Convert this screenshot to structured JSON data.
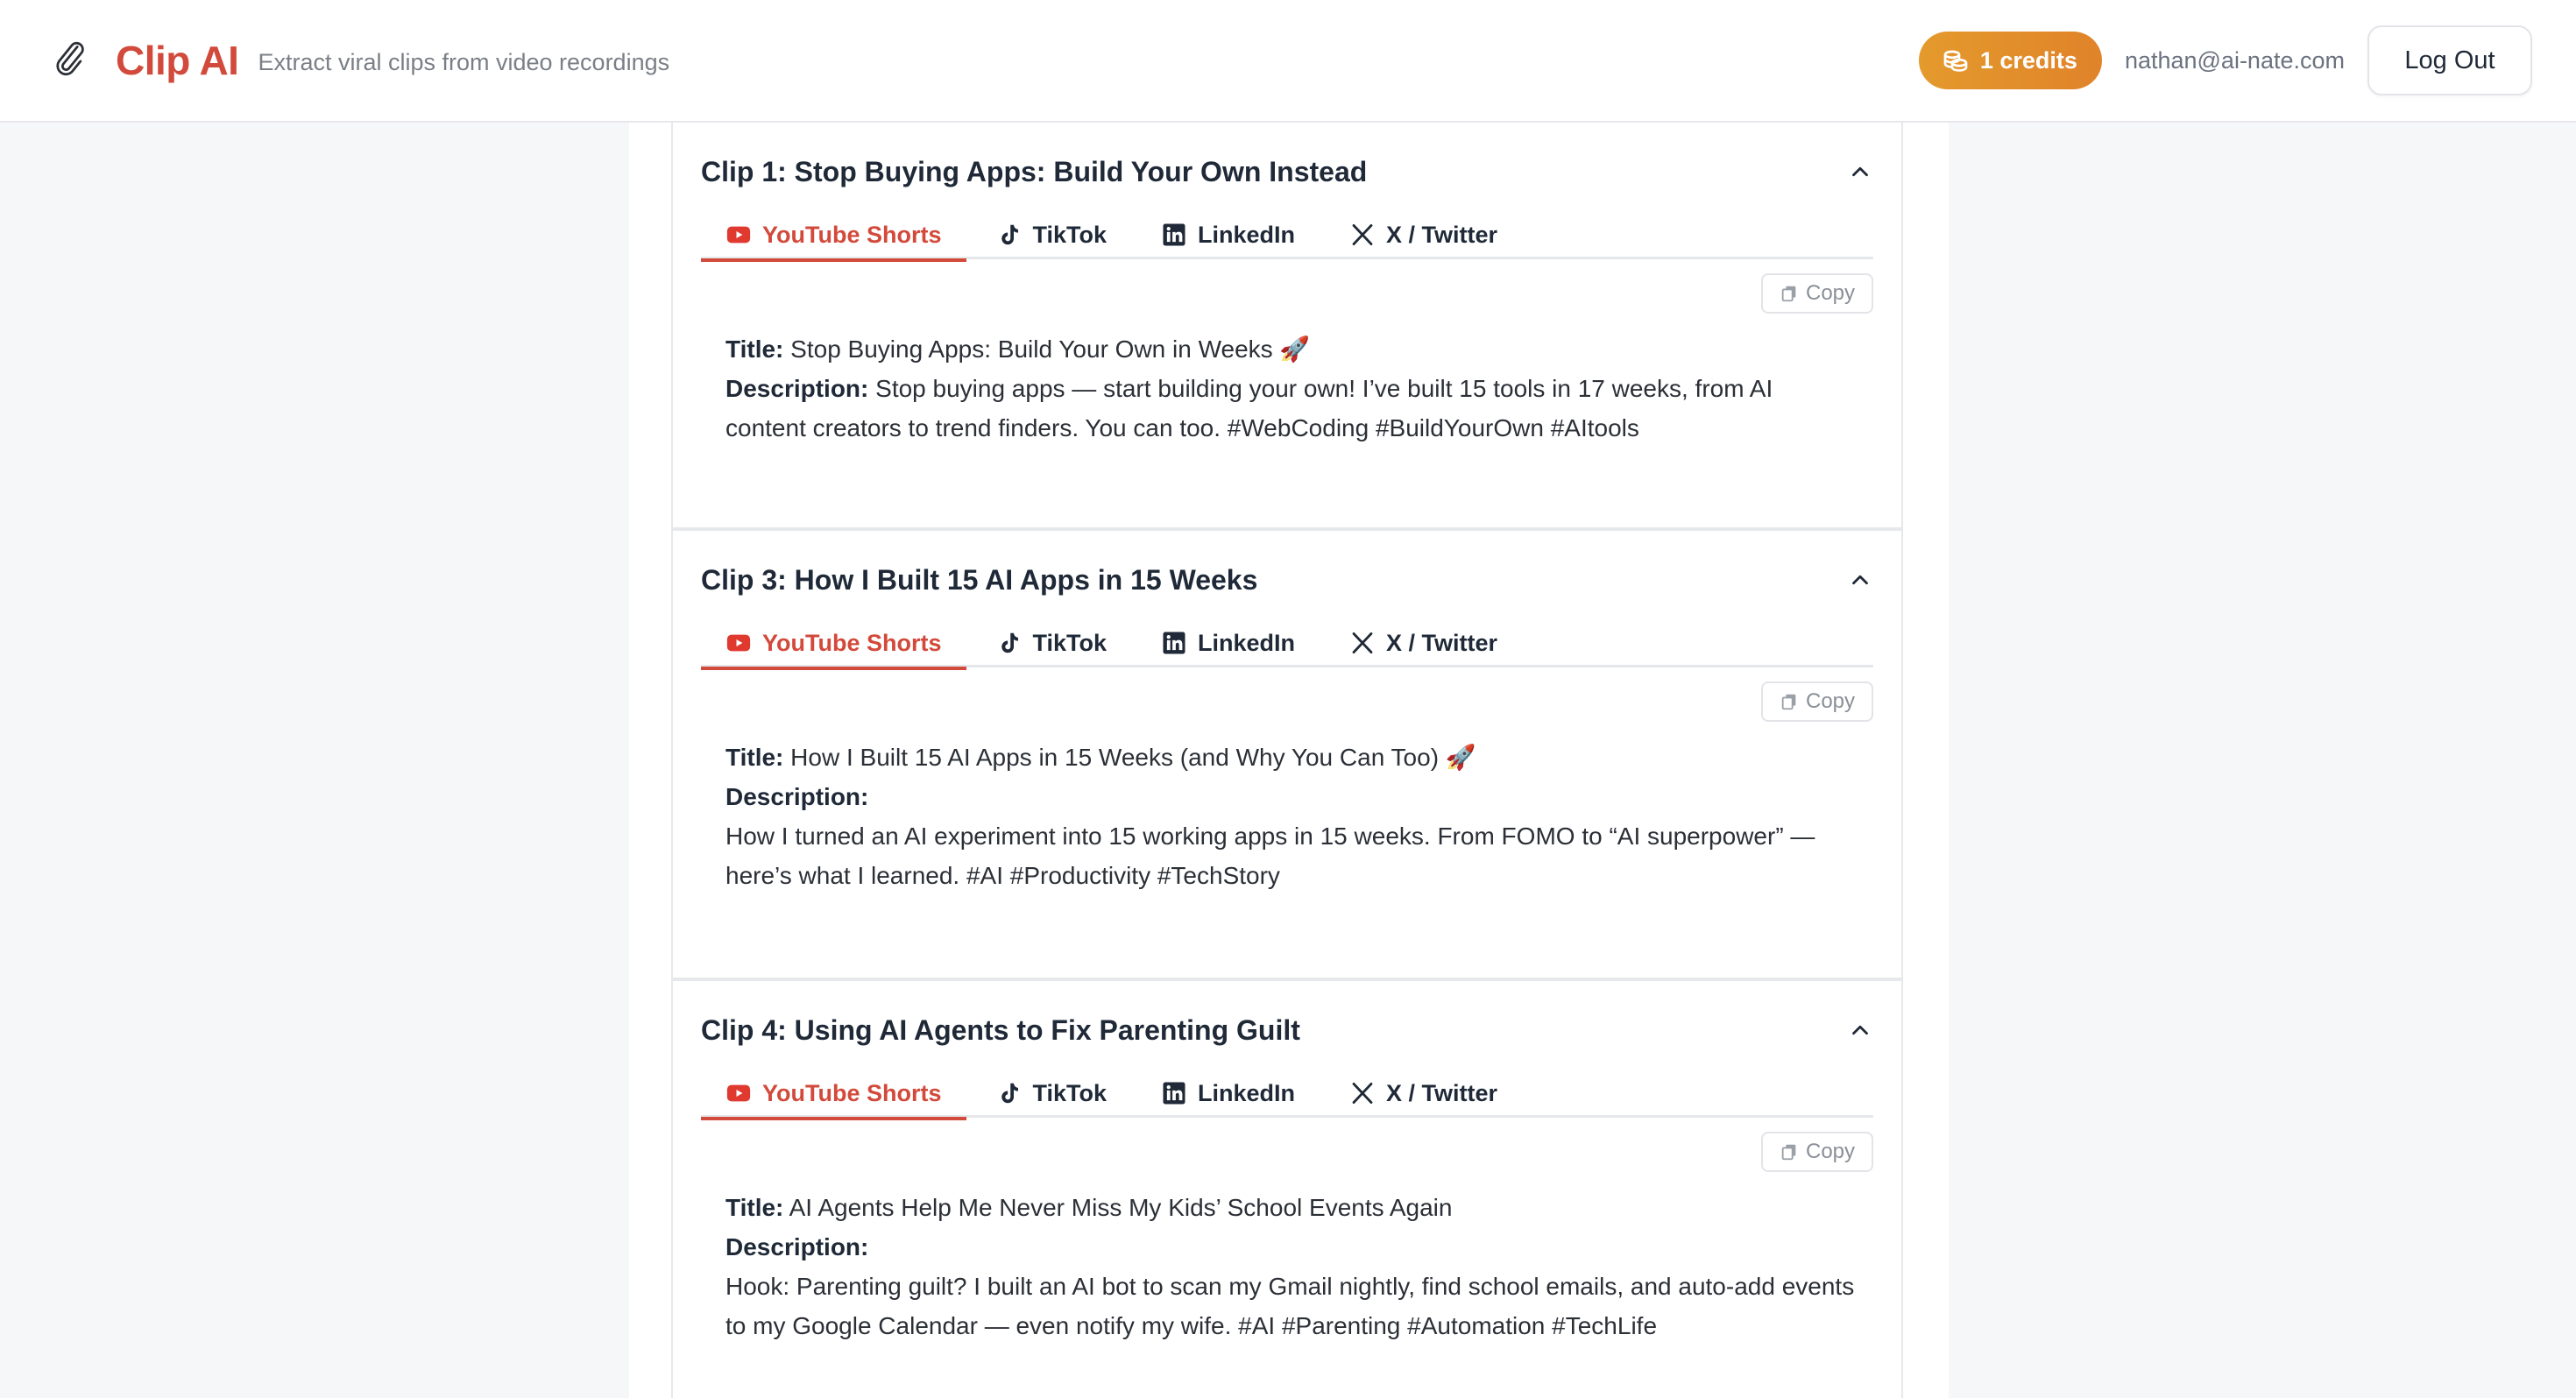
{
  "app": {
    "name": "Clip AI",
    "tagline": "Extract viral clips from video recordings"
  },
  "header": {
    "credits_label": "1 credits",
    "user_email": "nathan@ai-nate.com",
    "logout_label": "Log Out"
  },
  "colors": {
    "brand": "#d24a3b",
    "credits_badge": "#e0902b",
    "youtube_red": "#e0392f"
  },
  "tabs": {
    "youtube": "YouTube Shorts",
    "tiktok": "TikTok",
    "linkedin": "LinkedIn",
    "twitter": "X / Twitter"
  },
  "labels": {
    "copy": "Copy",
    "title": "Title:",
    "description": "Description:"
  },
  "clips": [
    {
      "heading": "Clip 1: Stop Buying Apps: Build Your Own Instead",
      "active_tab": "YouTube Shorts",
      "title": "Stop Buying Apps: Build Your Own in Weeks 🚀",
      "description": "Stop buying apps — start building your own! I’ve built 15 tools in 17 weeks, from AI content creators to trend finders. You can too. #WebCoding #BuildYourOwn #AItools"
    },
    {
      "heading": "Clip 3: How I Built 15 AI Apps in 15 Weeks",
      "active_tab": "YouTube Shorts",
      "title": "How I Built 15 AI Apps in 15 Weeks (and Why You Can Too) 🚀",
      "description": "How I turned an AI experiment into 15 working apps in 15 weeks. From FOMO to “AI superpower” — here’s what I learned. #AI #Productivity #TechStory"
    },
    {
      "heading": "Clip 4: Using AI Agents to Fix Parenting Guilt",
      "active_tab": "YouTube Shorts",
      "title": "AI Agents Help Me Never Miss My Kids’ School Events Again",
      "description": "Hook: Parenting guilt? I built an AI bot to scan my Gmail nightly, find school emails, and auto-add events to my Google Calendar — even notify my wife. #AI #Parenting #Automation #TechLife"
    }
  ]
}
